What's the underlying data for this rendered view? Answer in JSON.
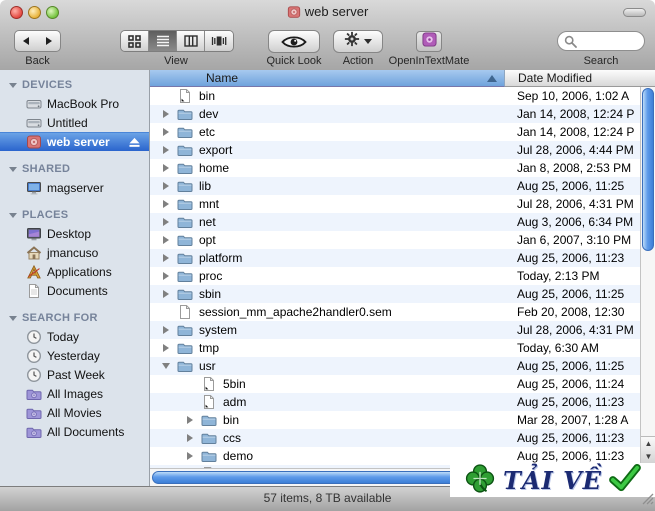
{
  "window": {
    "title": "web server"
  },
  "toolbar": {
    "back_label": "Back",
    "view_label": "View",
    "quicklook_label": "Quick Look",
    "action_label": "Action",
    "textmate_label": "OpenInTextMate",
    "search_label": "Search",
    "search_value": "",
    "view_modes": [
      "icon-view",
      "list-view",
      "column-view",
      "coverflow-view"
    ],
    "view_selected": "list-view"
  },
  "sidebar": {
    "sections": [
      {
        "title": "DEVICES",
        "items": [
          {
            "label": "MacBook Pro",
            "icon": "hard-drive-icon",
            "selected": false
          },
          {
            "label": "Untitled",
            "icon": "hard-drive-icon",
            "selected": false
          },
          {
            "label": "web server",
            "icon": "red-disk-icon",
            "selected": true,
            "eject": true
          }
        ]
      },
      {
        "title": "SHARED",
        "items": [
          {
            "label": "magserver",
            "icon": "display-icon",
            "selected": false
          }
        ]
      },
      {
        "title": "PLACES",
        "items": [
          {
            "label": "Desktop",
            "icon": "desktop-icon",
            "selected": false
          },
          {
            "label": "jmancuso",
            "icon": "home-icon",
            "selected": false
          },
          {
            "label": "Applications",
            "icon": "applications-icon",
            "selected": false
          },
          {
            "label": "Documents",
            "icon": "document-icon",
            "selected": false
          }
        ]
      },
      {
        "title": "SEARCH FOR",
        "items": [
          {
            "label": "Today",
            "icon": "clock-icon",
            "selected": false
          },
          {
            "label": "Yesterday",
            "icon": "clock-icon",
            "selected": false
          },
          {
            "label": "Past Week",
            "icon": "clock-icon",
            "selected": false
          },
          {
            "label": "All Images",
            "icon": "smart-folder-icon",
            "selected": false
          },
          {
            "label": "All Movies",
            "icon": "smart-folder-icon",
            "selected": false
          },
          {
            "label": "All Documents",
            "icon": "smart-folder-icon",
            "selected": false
          }
        ]
      }
    ]
  },
  "list": {
    "columns": [
      {
        "label": "Name",
        "sorted": true,
        "sort_dir": "asc"
      },
      {
        "label": "Date Modified",
        "sorted": false
      }
    ],
    "rows": [
      {
        "name": "bin",
        "icon": "alias-file",
        "level": 0,
        "disclosure": "none",
        "date": "Sep 10, 2006, 1:02 A"
      },
      {
        "name": "dev",
        "icon": "folder",
        "level": 0,
        "disclosure": "collapsed",
        "date": "Jan 14, 2008, 12:24 P"
      },
      {
        "name": "etc",
        "icon": "folder",
        "level": 0,
        "disclosure": "collapsed",
        "date": "Jan 14, 2008, 12:24 P"
      },
      {
        "name": "export",
        "icon": "folder",
        "level": 0,
        "disclosure": "collapsed",
        "date": "Jul 28, 2006, 4:44 PM"
      },
      {
        "name": "home",
        "icon": "folder",
        "level": 0,
        "disclosure": "collapsed",
        "date": "Jan 8, 2008, 2:53 PM"
      },
      {
        "name": "lib",
        "icon": "folder",
        "level": 0,
        "disclosure": "collapsed",
        "date": "Aug 25, 2006, 11:25"
      },
      {
        "name": "mnt",
        "icon": "folder",
        "level": 0,
        "disclosure": "collapsed",
        "date": "Jul 28, 2006, 4:31 PM"
      },
      {
        "name": "net",
        "icon": "folder",
        "level": 0,
        "disclosure": "collapsed",
        "date": "Aug 3, 2006, 6:34 PM"
      },
      {
        "name": "opt",
        "icon": "folder",
        "level": 0,
        "disclosure": "collapsed",
        "date": "Jan 6, 2007, 3:10 PM"
      },
      {
        "name": "platform",
        "icon": "folder",
        "level": 0,
        "disclosure": "collapsed",
        "date": "Aug 25, 2006, 11:23"
      },
      {
        "name": "proc",
        "icon": "folder",
        "level": 0,
        "disclosure": "collapsed",
        "date": "Today, 2:13 PM"
      },
      {
        "name": "sbin",
        "icon": "folder",
        "level": 0,
        "disclosure": "collapsed",
        "date": "Aug 25, 2006, 11:25"
      },
      {
        "name": "session_mm_apache2handler0.sem",
        "icon": "file",
        "level": 0,
        "disclosure": "none",
        "date": "Feb 20, 2008, 12:30"
      },
      {
        "name": "system",
        "icon": "folder",
        "level": 0,
        "disclosure": "collapsed",
        "date": "Jul 28, 2006, 4:31 PM"
      },
      {
        "name": "tmp",
        "icon": "folder",
        "level": 0,
        "disclosure": "collapsed",
        "date": "Today, 6:30 AM"
      },
      {
        "name": "usr",
        "icon": "folder",
        "level": 0,
        "disclosure": "expanded",
        "date": "Aug 25, 2006, 11:25"
      },
      {
        "name": "5bin",
        "icon": "alias-file",
        "level": 1,
        "disclosure": "none",
        "date": "Aug 25, 2006, 11:24"
      },
      {
        "name": "adm",
        "icon": "alias-file",
        "level": 1,
        "disclosure": "none",
        "date": "Aug 25, 2006, 11:23"
      },
      {
        "name": "bin",
        "icon": "folder",
        "level": 1,
        "disclosure": "collapsed",
        "date": "Mar 28, 2007, 1:28 A"
      },
      {
        "name": "ccs",
        "icon": "folder",
        "level": 1,
        "disclosure": "collapsed",
        "date": "Aug 25, 2006, 11:23"
      },
      {
        "name": "demo",
        "icon": "folder",
        "level": 1,
        "disclosure": "collapsed",
        "date": "Aug 25, 2006, 11:23"
      },
      {
        "name": "",
        "icon": "file",
        "level": 1,
        "disclosure": "none",
        "date": ""
      }
    ]
  },
  "statusbar": {
    "text": "57 items, 8 TB available"
  },
  "watermark": {
    "text": "TẢI VỀ"
  },
  "colors": {
    "selection_blue": "#2a64cd",
    "row_alt_blue": "#eef4fd",
    "header_blue": "#6fa3dc",
    "sidebar_bg": "#dce3eb",
    "watermark_text": "#1b2a72",
    "watermark_green": "#2f9e33"
  }
}
